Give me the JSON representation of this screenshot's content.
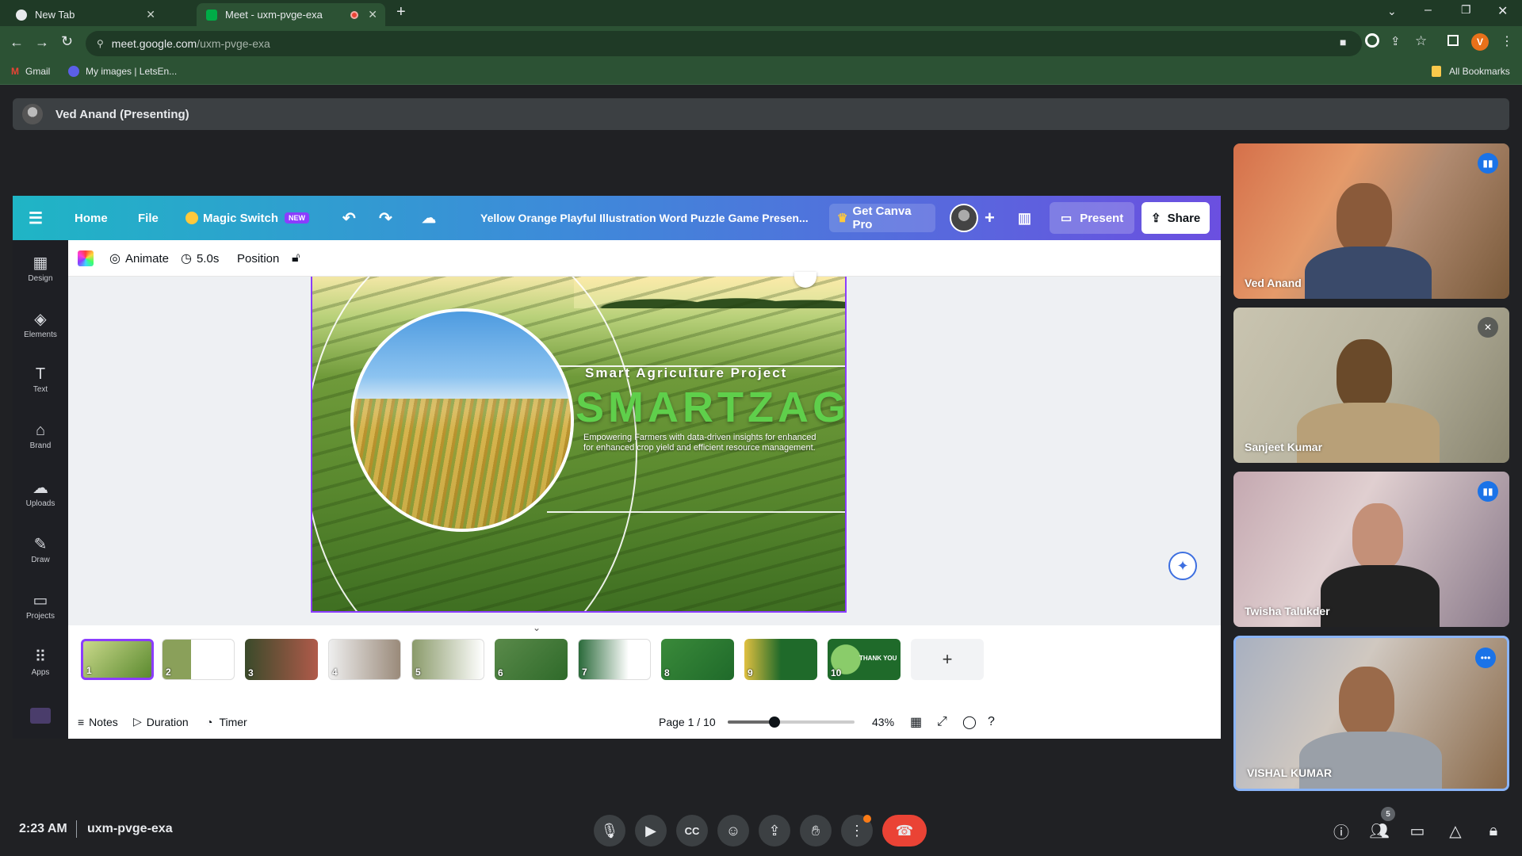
{
  "browser": {
    "tabs": [
      {
        "label": "New Tab",
        "close": "✕"
      },
      {
        "label": "Meet - uxm-pvge-exa",
        "close": "✕"
      }
    ],
    "new_tab": "+",
    "url_host": "meet.google.com",
    "url_path": "/uxm-pvge-exa",
    "bookmarks": [
      "Gmail",
      "My images | LetsEn..."
    ],
    "all_bookmarks": "All Bookmarks",
    "profile_initial": "V"
  },
  "meet": {
    "presenter_label": "Ved Anand (Presenting)",
    "time": "2:23 AM",
    "meeting_code": "uxm-pvge-exa",
    "people_count": "5",
    "participants": [
      {
        "name": "Ved Anand",
        "status": "speaking"
      },
      {
        "name": "Sanjeet Kumar",
        "status": "muted"
      },
      {
        "name": "Twisha Talukder",
        "status": "speaking"
      },
      {
        "name": "VISHAL KUMAR",
        "status": "more-options"
      }
    ]
  },
  "canva": {
    "menu": [
      "Home",
      "File"
    ],
    "magic_switch": "Magic Switch",
    "new_badge": "NEW",
    "doc_title": "Yellow Orange Playful Illustration Word Puzzle Game Presen...",
    "get_pro": "Get Canva Pro",
    "present": "Present",
    "share": "Share",
    "sidebar": [
      "Design",
      "Elements",
      "Text",
      "Brand",
      "Uploads",
      "Draw",
      "Projects",
      "Apps"
    ],
    "editor": {
      "animate": "Animate",
      "duration": "5.0s",
      "position": "Position"
    },
    "slide": {
      "subtitle": "Smart Agriculture Project",
      "title": "SMARTZAGRI",
      "tagline_1": "Empowering Farmers with data-driven insights for enhanced",
      "tagline_2": "for enhanced crop yield and efficient resource management."
    },
    "thumbnails": [
      "1",
      "2",
      "3",
      "4",
      "5",
      "6",
      "7",
      "8",
      "9",
      "10"
    ],
    "thumb_10_text": "THANK YOU",
    "add_page": "+",
    "bottom": {
      "notes": "Notes",
      "duration": "Duration",
      "timer": "Timer",
      "page": "Page 1 / 10",
      "zoom": "43%"
    },
    "zoom_fraction": 0.37
  },
  "colors": {
    "meet_bg": "#202124",
    "chrome_green": "#2c5234",
    "canva_purple": "#8b3dff",
    "end_call": "#ea4335",
    "agri_green": "#5fcf4b"
  }
}
